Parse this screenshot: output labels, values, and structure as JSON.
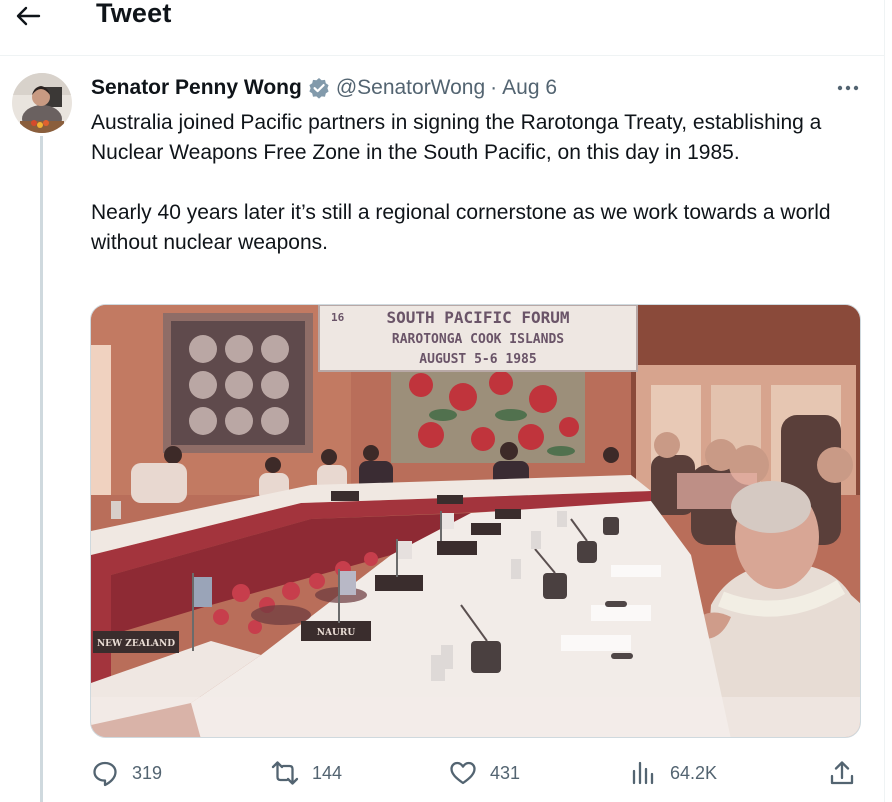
{
  "header": {
    "title": "Tweet",
    "back_icon": "arrow-left-icon"
  },
  "tweet": {
    "author_name": "Senator Penny Wong",
    "verified_icon": "verified-badge-icon",
    "handle": "@SenatorWong",
    "separator": "·",
    "date": "Aug 6",
    "more_icon": "more-horizontal-icon",
    "paragraphs": [
      "Australia joined Pacific partners in signing the Rarotonga Treaty, establishing a Nuclear Weapons Free Zone in the South Pacific, on this day in 1985.",
      "Nearly 40 years later it’s still a regional cornerstone as we work towards a world without nuclear weapons."
    ],
    "media": {
      "banner_lines": [
        "SOUTH PACIFIC FORUM",
        "RAROTONGA COOK ISLANDS",
        "AUGUST 5-6 1985"
      ],
      "banner_number": "16",
      "nameplates": [
        "NEW ZEALAND",
        "NAURU"
      ]
    }
  },
  "actions": {
    "replies": "319",
    "retweets": "144",
    "likes": "431",
    "views": "64.2K"
  },
  "colors": {
    "text": "#0f1419",
    "secondary": "#536471",
    "verified": "#829aab",
    "border": "#eff3f4"
  }
}
